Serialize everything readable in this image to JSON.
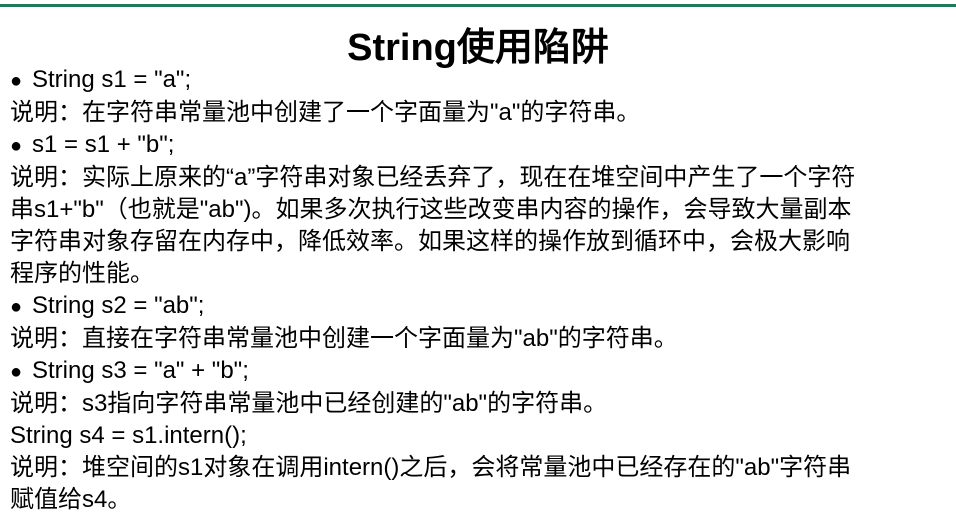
{
  "slide": {
    "title": "String使用陷阱"
  },
  "items": [
    {
      "text": "String s1 = \"a\";"
    },
    {
      "text": "说明：在字符串常量池中创建了一个字面量为\"a\"的字符串。"
    },
    {
      "text": "s1 = s1 + \"b\";"
    },
    {
      "text": "说明：实际上原来的“a”字符串对象已经丢弃了，现在在堆空间中产生了一个字符"
    },
    {
      "text": "串s1+\"b\"（也就是\"ab\")。如果多次执行这些改变串内容的操作，会导致大量副本"
    },
    {
      "text": "字符串对象存留在内存中，降低效率。如果这样的操作放到循环中，会极大影响"
    },
    {
      "text": "程序的性能。"
    },
    {
      "text": "String s2 = \"ab\";"
    },
    {
      "text": "说明：直接在字符串常量池中创建一个字面量为\"ab\"的字符串。"
    },
    {
      "text": "String s3 = \"a\" + \"b\";"
    },
    {
      "text": "说明：s3指向字符串常量池中已经创建的\"ab\"的字符串。"
    },
    {
      "text": "String s4 = s1.intern();"
    },
    {
      "text": "说明：堆空间的s1对象在调用intern()之后，会将常量池中已经存在的\"ab\"字符串"
    },
    {
      "text": "赋值给s4。"
    }
  ],
  "colors": {
    "rule": "#1f7a5a",
    "text": "#000000",
    "background": "#ffffff"
  }
}
